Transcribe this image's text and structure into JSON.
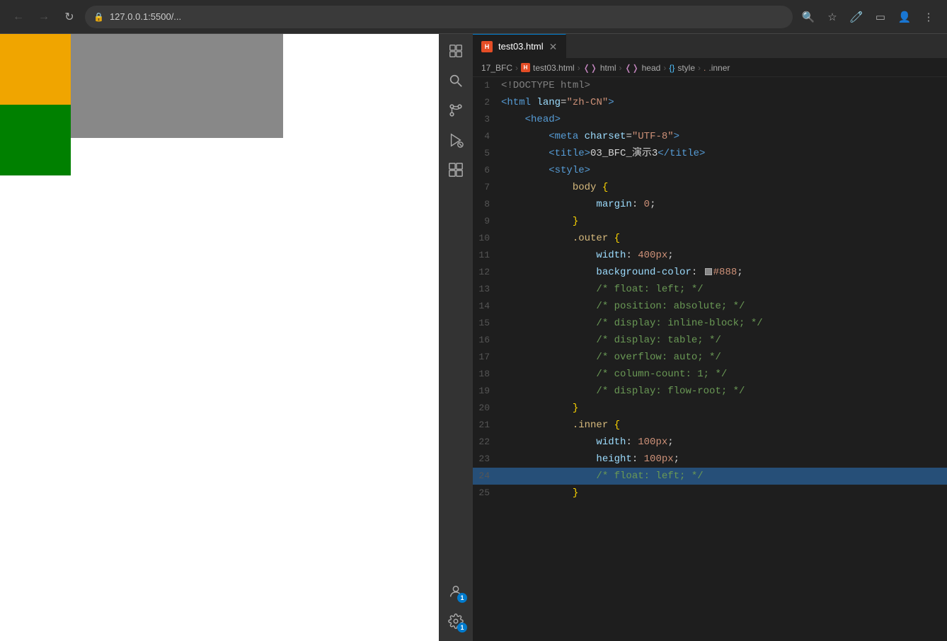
{
  "browser": {
    "url": "127.0.0.1:5500/...",
    "back_disabled": true,
    "forward_disabled": true
  },
  "tab": {
    "label": "test03.html",
    "icon": "HTML"
  },
  "breadcrumb": {
    "project": "17_BFC",
    "file": "test03.html",
    "nodes": [
      "html",
      "head",
      "style",
      ".inner"
    ]
  },
  "activity_icons": {
    "explorer": "⊞",
    "search": "🔍",
    "source_control": "⑂",
    "run": "▷",
    "extensions": "⬛",
    "accounts_badge": "1",
    "settings_badge": "1"
  },
  "preview": {
    "outer_width": 400,
    "outer_height": 147,
    "outer_color": "#888888",
    "box1_color": "#f0a500",
    "box2_color": "#008000"
  },
  "code_lines": [
    {
      "num": 1,
      "tokens": [
        {
          "t": "doctype",
          "v": "<!DOCTYPE html>"
        }
      ]
    },
    {
      "num": 2,
      "tokens": [
        {
          "t": "tag",
          "v": "<html"
        },
        {
          "t": "attr-name",
          "v": " lang"
        },
        {
          "t": "punct",
          "v": "="
        },
        {
          "t": "attr-val",
          "v": "\"zh-CN\""
        },
        {
          "t": "tag",
          "v": ">"
        }
      ]
    },
    {
      "num": 3,
      "tokens": [
        {
          "t": "tag",
          "v": "<head>"
        }
      ]
    },
    {
      "num": 4,
      "tokens": [
        {
          "t": "indent",
          "v": "    "
        },
        {
          "t": "tag",
          "v": "<meta"
        },
        {
          "t": "attr-name",
          "v": " charset"
        },
        {
          "t": "punct",
          "v": "="
        },
        {
          "t": "attr-val",
          "v": "\"UTF-8\""
        },
        {
          "t": "tag",
          "v": ">"
        }
      ]
    },
    {
      "num": 5,
      "tokens": [
        {
          "t": "indent",
          "v": "    "
        },
        {
          "t": "tag",
          "v": "<title>"
        },
        {
          "t": "text",
          "v": "03_BFC_演示3"
        },
        {
          "t": "tag",
          "v": "</title>"
        }
      ]
    },
    {
      "num": 6,
      "tokens": [
        {
          "t": "indent",
          "v": "    "
        },
        {
          "t": "tag",
          "v": "<style>"
        }
      ]
    },
    {
      "num": 7,
      "tokens": [
        {
          "t": "indent",
          "v": "        "
        },
        {
          "t": "selector",
          "v": "body"
        },
        {
          "t": "text",
          "v": " {"
        }
      ]
    },
    {
      "num": 8,
      "tokens": [
        {
          "t": "indent",
          "v": "            "
        },
        {
          "t": "property",
          "v": "margin"
        },
        {
          "t": "text",
          "v": ": "
        },
        {
          "t": "value",
          "v": "0"
        },
        {
          "t": "text",
          "v": ";"
        }
      ]
    },
    {
      "num": 9,
      "tokens": [
        {
          "t": "indent",
          "v": "        "
        },
        {
          "t": "text",
          "v": "}"
        }
      ]
    },
    {
      "num": 10,
      "tokens": [
        {
          "t": "indent",
          "v": "        "
        },
        {
          "t": "selector",
          "v": ".outer"
        },
        {
          "t": "text",
          "v": " {"
        }
      ]
    },
    {
      "num": 11,
      "tokens": [
        {
          "t": "indent",
          "v": "            "
        },
        {
          "t": "property",
          "v": "width"
        },
        {
          "t": "text",
          "v": ": "
        },
        {
          "t": "value",
          "v": "400px"
        },
        {
          "t": "text",
          "v": ";"
        }
      ]
    },
    {
      "num": 12,
      "tokens": [
        {
          "t": "indent",
          "v": "            "
        },
        {
          "t": "property",
          "v": "background-color"
        },
        {
          "t": "text",
          "v": ": "
        },
        {
          "t": "swatch",
          "v": "#888"
        },
        {
          "t": "value",
          "v": "#888"
        },
        {
          "t": "text",
          "v": ";"
        }
      ]
    },
    {
      "num": 13,
      "tokens": [
        {
          "t": "indent",
          "v": "            "
        },
        {
          "t": "comment",
          "v": "/* float: left; */"
        }
      ]
    },
    {
      "num": 14,
      "tokens": [
        {
          "t": "indent",
          "v": "            "
        },
        {
          "t": "comment",
          "v": "/* position: absolute; */"
        }
      ]
    },
    {
      "num": 15,
      "tokens": [
        {
          "t": "indent",
          "v": "            "
        },
        {
          "t": "comment",
          "v": "/* display: inline-block; */"
        }
      ]
    },
    {
      "num": 16,
      "tokens": [
        {
          "t": "indent",
          "v": "            "
        },
        {
          "t": "comment",
          "v": "/* display: table; */"
        }
      ]
    },
    {
      "num": 17,
      "tokens": [
        {
          "t": "indent",
          "v": "            "
        },
        {
          "t": "comment",
          "v": "/* overflow: auto; */"
        }
      ]
    },
    {
      "num": 18,
      "tokens": [
        {
          "t": "indent",
          "v": "            "
        },
        {
          "t": "comment",
          "v": "/* column-count: 1; */"
        }
      ]
    },
    {
      "num": 19,
      "tokens": [
        {
          "t": "indent",
          "v": "            "
        },
        {
          "t": "comment",
          "v": "/* display: flow-root; */"
        }
      ]
    },
    {
      "num": 20,
      "tokens": [
        {
          "t": "indent",
          "v": "        "
        },
        {
          "t": "text",
          "v": "}"
        }
      ]
    },
    {
      "num": 21,
      "tokens": [
        {
          "t": "indent",
          "v": "        "
        },
        {
          "t": "selector",
          "v": ".inner"
        },
        {
          "t": "text",
          "v": " {"
        }
      ]
    },
    {
      "num": 22,
      "tokens": [
        {
          "t": "indent",
          "v": "            "
        },
        {
          "t": "property",
          "v": "width"
        },
        {
          "t": "text",
          "v": ": "
        },
        {
          "t": "value",
          "v": "100px"
        },
        {
          "t": "text",
          "v": ";"
        }
      ]
    },
    {
      "num": 23,
      "tokens": [
        {
          "t": "indent",
          "v": "            "
        },
        {
          "t": "property",
          "v": "height"
        },
        {
          "t": "text",
          "v": ": "
        },
        {
          "t": "value",
          "v": "100px"
        },
        {
          "t": "text",
          "v": ";"
        }
      ]
    },
    {
      "num": 24,
      "tokens": [
        {
          "t": "indent",
          "v": "            "
        },
        {
          "t": "comment",
          "v": "/* float: left; */"
        }
      ]
    },
    {
      "num": 25,
      "tokens": [
        {
          "t": "indent",
          "v": "        "
        },
        {
          "t": "text",
          "v": "}"
        }
      ]
    }
  ]
}
